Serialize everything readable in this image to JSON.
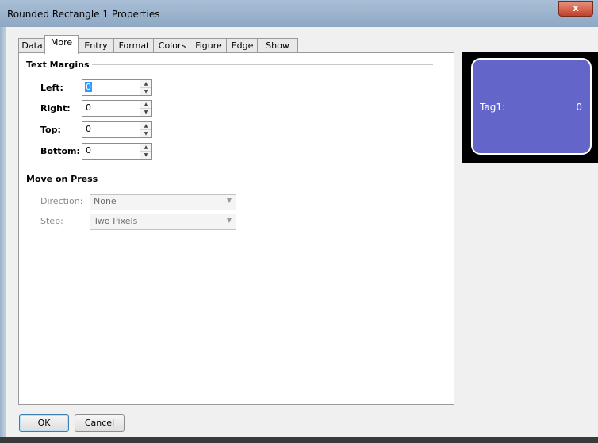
{
  "window": {
    "title": "Rounded Rectangle 1 Properties",
    "close_glyph": "x"
  },
  "tabs": [
    {
      "label": "Data"
    },
    {
      "label": "More"
    },
    {
      "label": "Entry"
    },
    {
      "label": "Format"
    },
    {
      "label": "Colors"
    },
    {
      "label": "Figure"
    },
    {
      "label": "Edge"
    },
    {
      "label": "Show"
    }
  ],
  "active_tab": "More",
  "text_margins": {
    "heading": "Text Margins",
    "fields": [
      {
        "label": "Left:",
        "value": "0"
      },
      {
        "label": "Right:",
        "value": "0"
      },
      {
        "label": "Top:",
        "value": "0"
      },
      {
        "label": "Bottom:",
        "value": "0"
      }
    ]
  },
  "move_on_press": {
    "heading": "Move on Press",
    "direction": {
      "label": "Direction:",
      "value": "None"
    },
    "step": {
      "label": "Step:",
      "value": "Two Pixels"
    }
  },
  "preview": {
    "tag_label": "Tag1:",
    "tag_value": "0",
    "fill_color": "#6366c8",
    "background_color": "#000000"
  },
  "buttons": {
    "ok": "OK",
    "cancel": "Cancel"
  }
}
